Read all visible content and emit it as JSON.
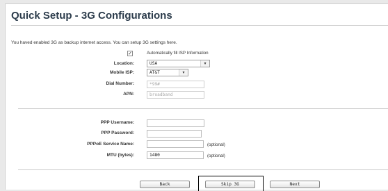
{
  "header": {
    "title": "Quick Setup - 3G Configurations"
  },
  "intro": {
    "text": "You haved enabled 3G as backup internet access. You can setup 3G settings here."
  },
  "auto_isp": {
    "checked": true,
    "check_glyph": "✓",
    "label": "Automatically fill ISP Information"
  },
  "location": {
    "label": "Location:",
    "value": "USA",
    "arrow": "▾"
  },
  "mobile_isp": {
    "label": "Mobile ISP:",
    "value": "AT&T",
    "arrow": "▾"
  },
  "dial_number": {
    "label": "Dial Number:",
    "value": "*99#"
  },
  "apn": {
    "label": "APN:",
    "value": "broadband"
  },
  "ppp_username": {
    "label": "PPP Username:",
    "value": ""
  },
  "ppp_password": {
    "label": "PPP Password:",
    "value": ""
  },
  "pppoe_service": {
    "label": "PPPoE Service Name:",
    "value": "",
    "hint": "(optional)"
  },
  "mtu": {
    "label": "MTU (bytes):",
    "value": "1480",
    "hint": "(optional)"
  },
  "buttons": {
    "back": "Back",
    "skip": "Skip 3G",
    "next": "Next"
  }
}
